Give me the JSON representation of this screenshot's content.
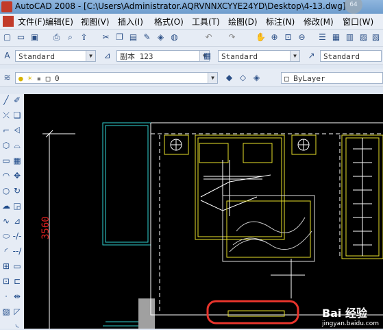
{
  "window": {
    "title": "AutoCAD 2008 - [C:\\Users\\Administrator.AQRVNNXCYYE24YD\\Desktop\\4-13.dwg]",
    "badge": "64"
  },
  "menu": [
    "文件(F)",
    "编辑(E)",
    "视图(V)",
    "插入(I)",
    "格式(O)",
    "工具(T)",
    "绘图(D)",
    "标注(N)",
    "修改(M)",
    "窗口(W)"
  ],
  "styles_toolbar": {
    "text_style": "Standard",
    "dim_style": "副本 123",
    "table_style": "Standard",
    "multileader_style": "Standard"
  },
  "layers_toolbar": {
    "layer": "0",
    "color": "ByLayer"
  },
  "drawing": {
    "dimension_text": "3560"
  },
  "watermark": {
    "brand": "Bai 经验",
    "url": "jingyan.baidu.com"
  },
  "colors": {
    "cyan": "#2fd3d3",
    "yellow": "#e8e02a",
    "white": "#ffffff",
    "red": "#e02020",
    "highlight": "#e8342c"
  }
}
